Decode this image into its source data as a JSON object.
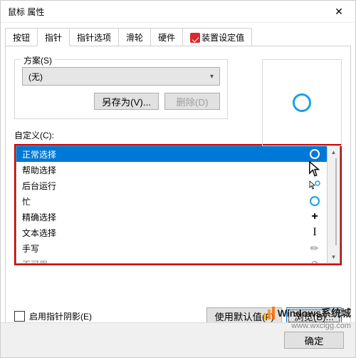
{
  "window": {
    "title": "鼠标 属性"
  },
  "tabs": [
    {
      "label": "按钮"
    },
    {
      "label": "指针"
    },
    {
      "label": "指针选项"
    },
    {
      "label": "滑轮"
    },
    {
      "label": "硬件"
    },
    {
      "label": "装置设定值"
    }
  ],
  "scheme": {
    "group_label": "方案(S)",
    "value": "(无)",
    "save_as": "另存为(V)...",
    "delete": "删除(D)"
  },
  "custom": {
    "label": "自定义(C):",
    "items": [
      {
        "label": "正常选择",
        "icon": "ring"
      },
      {
        "label": "帮助选择",
        "icon": "arrow-help"
      },
      {
        "label": "后台运行",
        "icon": "arrow-ring"
      },
      {
        "label": "忙",
        "icon": "ring"
      },
      {
        "label": "精确选择",
        "icon": "plus"
      },
      {
        "label": "文本选择",
        "icon": "ibeam"
      },
      {
        "label": "手写",
        "icon": "pen"
      },
      {
        "label": "不可用",
        "icon": "no"
      }
    ]
  },
  "shadow": {
    "label": "启用指针阴影(E)"
  },
  "buttons": {
    "defaults": "使用默认值(F)",
    "browse": "浏览(B)...",
    "ok": "确定"
  },
  "watermark": {
    "text": "Windows系统城",
    "url": "www.wxclgg.com"
  }
}
